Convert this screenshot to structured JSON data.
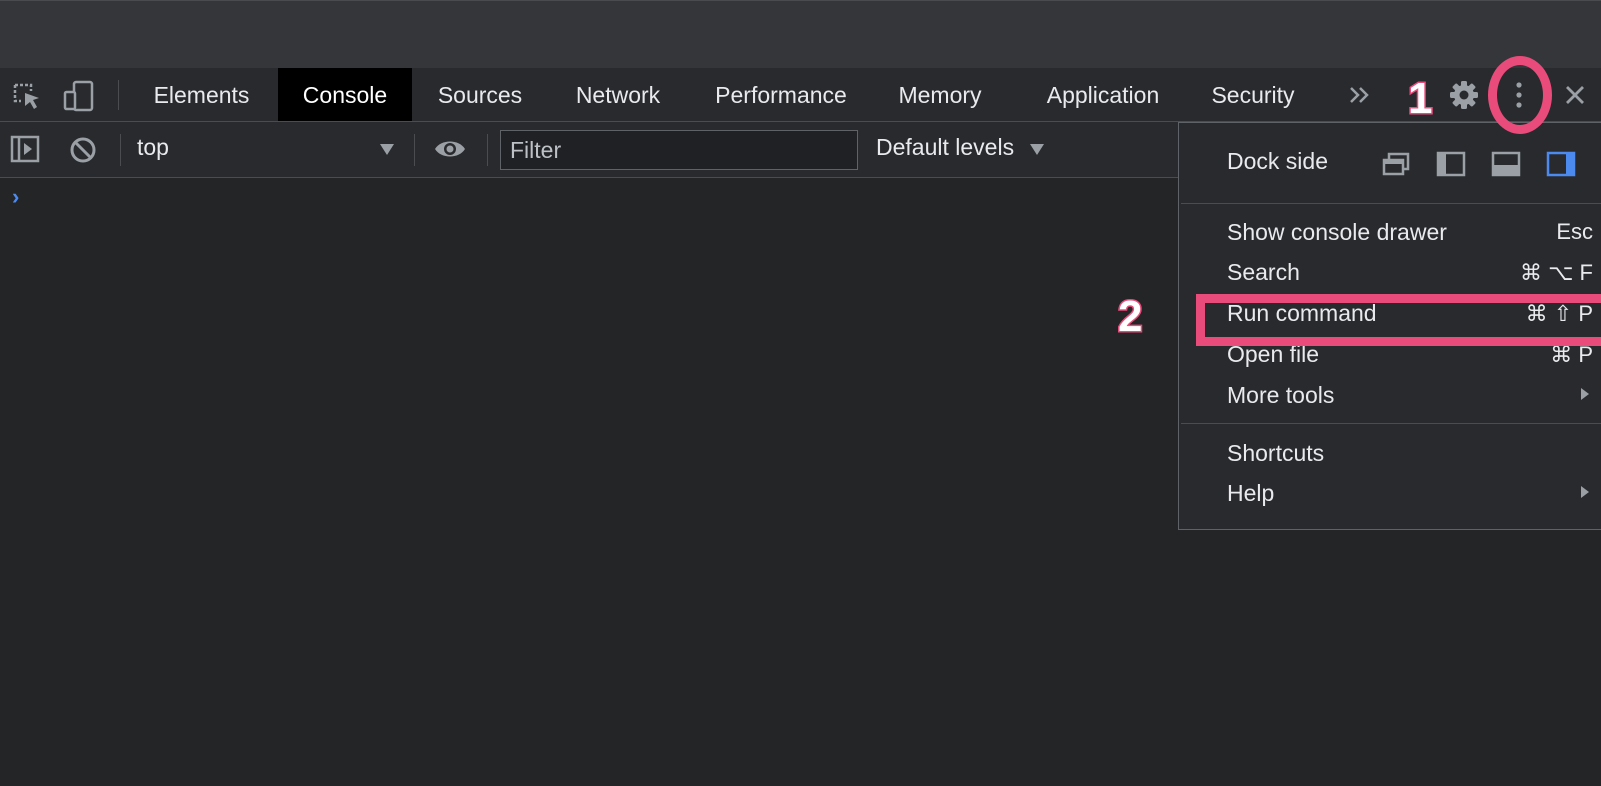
{
  "tabs": [
    {
      "label": "Elements",
      "active": false
    },
    {
      "label": "Console",
      "active": true
    },
    {
      "label": "Sources",
      "active": false
    },
    {
      "label": "Network",
      "active": false
    },
    {
      "label": "Performance",
      "active": false
    },
    {
      "label": "Memory",
      "active": false
    },
    {
      "label": "Application",
      "active": false
    },
    {
      "label": "Security",
      "active": false
    }
  ],
  "toolbar": {
    "context": "top",
    "filter_placeholder": "Filter",
    "levels": "Default levels"
  },
  "console": {
    "prompt": "›"
  },
  "menu": {
    "dock_side_label": "Dock side",
    "items": [
      {
        "label": "Show console drawer",
        "shortcut": "Esc"
      },
      {
        "label": "Search",
        "shortcut": "⌘ ⌥ F"
      },
      {
        "label": "Run command",
        "shortcut": "⌘ ⇧ P"
      },
      {
        "label": "Open file",
        "shortcut": "⌘ P"
      },
      {
        "label": "More tools",
        "shortcut": ""
      },
      {
        "label": "Shortcuts",
        "shortcut": ""
      },
      {
        "label": "Help",
        "shortcut": ""
      }
    ]
  },
  "annotations": {
    "step1": "1",
    "step2": "2"
  },
  "colors": {
    "accent": "#e94b7b",
    "dock_active": "#4d8af0",
    "panel": "#292a2d",
    "background": "#242527"
  }
}
